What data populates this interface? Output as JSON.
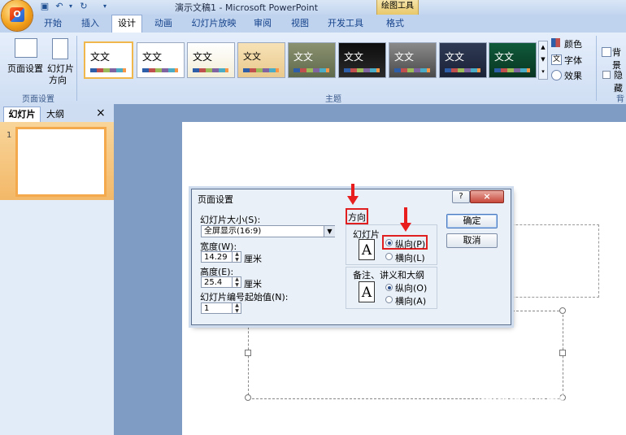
{
  "titlebar": {
    "doc_title": "演示文稿1 - Microsoft PowerPoint",
    "tools_tab": "绘图工具"
  },
  "tabs": [
    "开始",
    "插入",
    "设计",
    "动画",
    "幻灯片放映",
    "审阅",
    "视图",
    "开发工具",
    "格式"
  ],
  "ribbon": {
    "page_setup_btn": "页面设置",
    "orientation_btn_line1": "幻灯片",
    "orientation_btn_line2": "方向",
    "group_page_setup": "页面设置",
    "group_theme": "主题",
    "theme_text": "文文",
    "theme_text_alt": "文文",
    "colors": "颜色",
    "fonts": "字体",
    "effects": "效果",
    "background_styles": "背景",
    "hide_bg": "隐藏",
    "group_bg": "背"
  },
  "panel": {
    "tab_slides": "幻灯片",
    "tab_outline": "大纲",
    "close": "×",
    "slide_number": "1"
  },
  "dialog": {
    "title": "页面设置",
    "help": "?",
    "close": "×",
    "size_label": "幻灯片大小(S):",
    "size_value": "全屏显示(16:9)",
    "width_label": "宽度(W):",
    "width_value": "14.29",
    "width_unit": "厘米",
    "height_label": "高度(E):",
    "height_value": "25.4",
    "height_unit": "厘米",
    "numbering_label": "幻灯片编号起始值(N):",
    "numbering_value": "1",
    "orientation_title": "方向",
    "slides_group": "幻灯片",
    "slides_portrait": "纵向(P)",
    "slides_landscape": "横向(L)",
    "notes_group": "备注、讲义和大纲",
    "notes_portrait": "纵向(O)",
    "notes_landscape": "横向(A)",
    "ok": "确定",
    "cancel": "取消",
    "icon_letter": "A"
  },
  "watermark": {
    "brand": "Baidu经验",
    "url": "jingyan.baidu.com"
  }
}
